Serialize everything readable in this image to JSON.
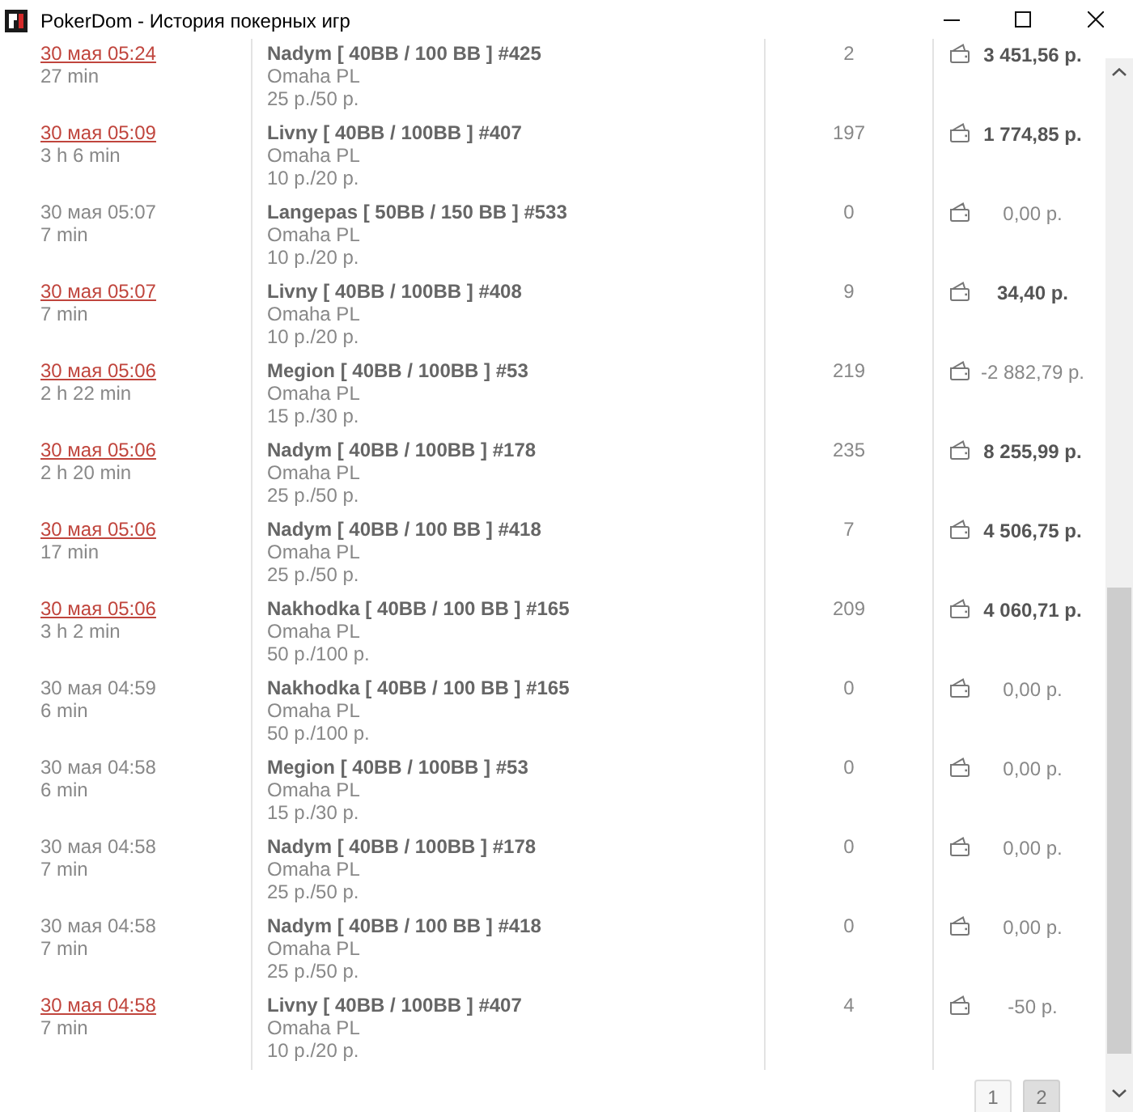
{
  "window": {
    "title": "PokerDom - История покерных игр"
  },
  "games": [
    {
      "date": "30 мая 05:24",
      "linked": true,
      "duration": "27 min",
      "table": "Nadym [ 40BB / 100 BB ] #425",
      "game": "Omaha PL",
      "stakes": "25 р./50 р.",
      "hands": "2",
      "result": "3 451,56 р.",
      "won": true
    },
    {
      "date": "30 мая 05:09",
      "linked": true,
      "duration": "3 h 6 min",
      "table": "Livny [ 40BB / 100BB ] #407",
      "game": "Omaha PL",
      "stakes": "10 р./20 р.",
      "hands": "197",
      "result": "1 774,85 р.",
      "won": true
    },
    {
      "date": "30 мая 05:07",
      "linked": false,
      "duration": "7 min",
      "table": "Langepas [ 50BB / 150 BB ] #533",
      "game": "Omaha PL",
      "stakes": "10 р./20 р.",
      "hands": "0",
      "result": "0,00 р.",
      "won": false
    },
    {
      "date": "30 мая 05:07",
      "linked": true,
      "duration": "7 min",
      "table": "Livny [ 40BB / 100BB ] #408",
      "game": "Omaha PL",
      "stakes": "10 р./20 р.",
      "hands": "9",
      "result": "34,40 р.",
      "won": true
    },
    {
      "date": "30 мая 05:06",
      "linked": true,
      "duration": "2 h 22 min",
      "table": "Megion [ 40BB / 100BB ] #53",
      "game": "Omaha PL",
      "stakes": "15 р./30 р.",
      "hands": "219",
      "result": "-2 882,79 р.",
      "won": false
    },
    {
      "date": "30 мая 05:06",
      "linked": true,
      "duration": "2 h 20 min",
      "table": "Nadym [ 40BB / 100BB ] #178",
      "game": "Omaha PL",
      "stakes": "25 р./50 р.",
      "hands": "235",
      "result": "8 255,99 р.",
      "won": true
    },
    {
      "date": "30 мая 05:06",
      "linked": true,
      "duration": "17 min",
      "table": "Nadym [ 40BB / 100 BB ] #418",
      "game": "Omaha PL",
      "stakes": "25 р./50 р.",
      "hands": "7",
      "result": "4 506,75 р.",
      "won": true
    },
    {
      "date": "30 мая 05:06",
      "linked": true,
      "duration": "3 h 2 min",
      "table": "Nakhodka [ 40BB / 100 BB ] #165",
      "game": "Omaha PL",
      "stakes": "50 р./100 р.",
      "hands": "209",
      "result": "4 060,71 р.",
      "won": true
    },
    {
      "date": "30 мая 04:59",
      "linked": false,
      "duration": "6 min",
      "table": "Nakhodka [ 40BB / 100 BB ] #165",
      "game": "Omaha PL",
      "stakes": "50 р./100 р.",
      "hands": "0",
      "result": "0,00 р.",
      "won": false
    },
    {
      "date": "30 мая 04:58",
      "linked": false,
      "duration": "6 min",
      "table": "Megion [ 40BB / 100BB ] #53",
      "game": "Omaha PL",
      "stakes": "15 р./30 р.",
      "hands": "0",
      "result": "0,00 р.",
      "won": false
    },
    {
      "date": "30 мая 04:58",
      "linked": false,
      "duration": "7 min",
      "table": "Nadym [ 40BB / 100BB ] #178",
      "game": "Omaha PL",
      "stakes": "25 р./50 р.",
      "hands": "0",
      "result": "0,00 р.",
      "won": false
    },
    {
      "date": "30 мая 04:58",
      "linked": false,
      "duration": "7 min",
      "table": "Nadym [ 40BB / 100 BB ] #418",
      "game": "Omaha PL",
      "stakes": "25 р./50 р.",
      "hands": "0",
      "result": "0,00 р.",
      "won": false
    },
    {
      "date": "30 мая 04:58",
      "linked": true,
      "duration": "7 min",
      "table": "Livny [ 40BB / 100BB ] #407",
      "game": "Omaha PL",
      "stakes": "10 р./20 р.",
      "hands": "4",
      "result": "-50 р.",
      "won": false
    }
  ],
  "pagination": [
    {
      "label": "1",
      "selected": false
    },
    {
      "label": "2",
      "selected": true
    }
  ]
}
